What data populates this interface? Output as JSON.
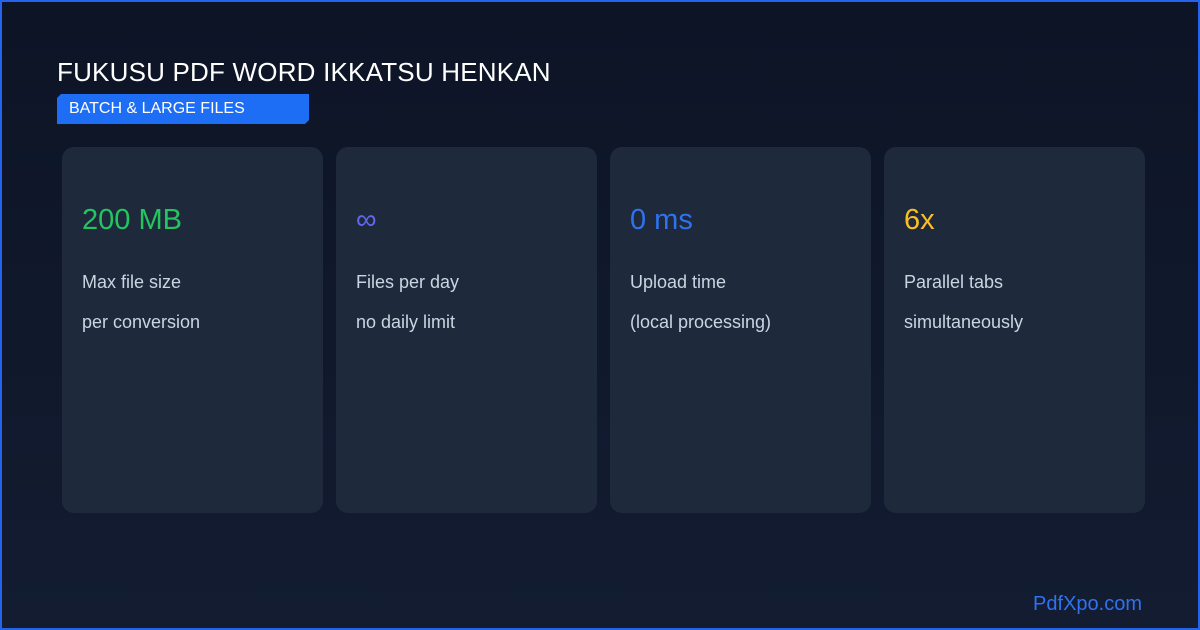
{
  "header": {
    "title": "FUKUSU PDF WORD IKKATSU HENKAN",
    "badge": "BATCH & LARGE FILES"
  },
  "cards": [
    {
      "value": "200 MB",
      "line1": "Max file size",
      "line2": "per conversion",
      "color": "#22c55e"
    },
    {
      "value": "∞",
      "line1": "Files per day",
      "line2": "no daily limit",
      "color": "#6366f1"
    },
    {
      "value": "0 ms",
      "line1": "Upload time",
      "line2": "(local processing)",
      "color": "#2f72f0"
    },
    {
      "value": "6x",
      "line1": "Parallel tabs",
      "line2": "simultaneously",
      "color": "#fbbf24"
    }
  ],
  "footer": {
    "brand": "PdfXpo.com"
  },
  "colors": {
    "accent": "#2563eb",
    "background": "#0f172a",
    "card": "#1e293b"
  }
}
